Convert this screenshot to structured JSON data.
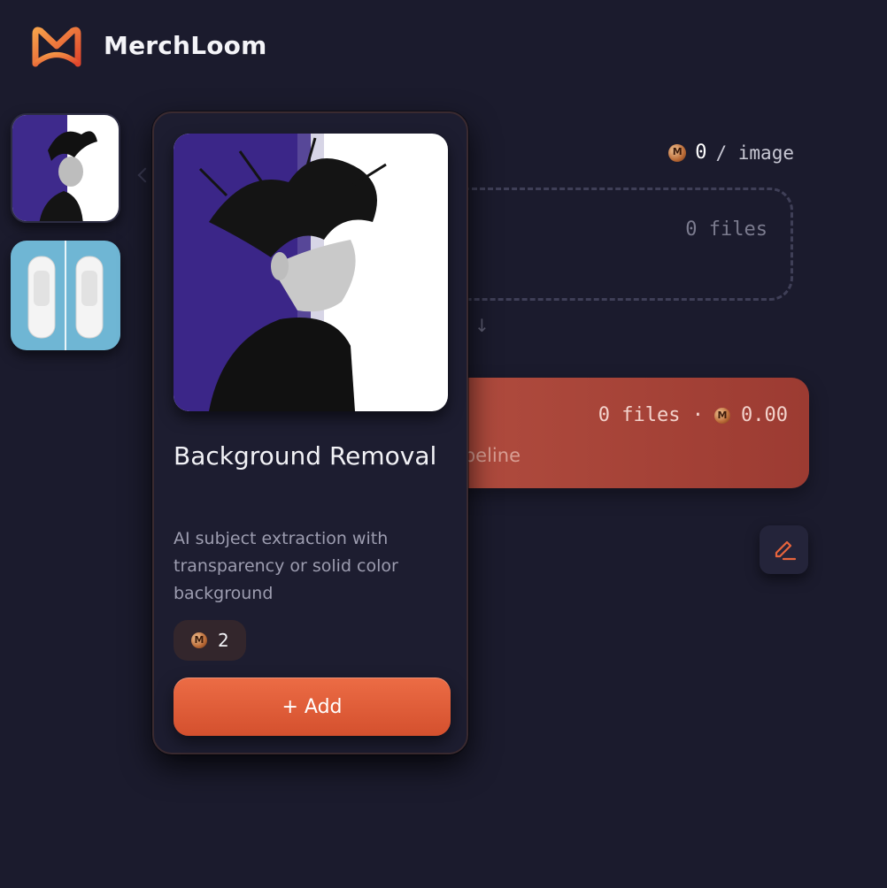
{
  "brand": {
    "name": "MerchLoom",
    "accent": "#e8643c"
  },
  "rate": {
    "value": "0",
    "unit": "/ image"
  },
  "dropzone": {
    "files": "0 files"
  },
  "pipeline": {
    "meta": "0 files ·",
    "cost": "0.00",
    "label": "ipeline",
    "color": "#b24d3f"
  },
  "card": {
    "title": "Background Removal",
    "description": "AI subject extraction with transparency or solid color background",
    "cost": "2",
    "add_label": "+ Add"
  },
  "thumbnails": [
    {
      "name": "background-removal",
      "selected": true
    },
    {
      "name": "sneakers-product"
    }
  ],
  "icons": [
    "merchloom-logo-icon",
    "coin-icon",
    "arrow-down-icon",
    "pencil-icon",
    "chevron-left-icon"
  ]
}
